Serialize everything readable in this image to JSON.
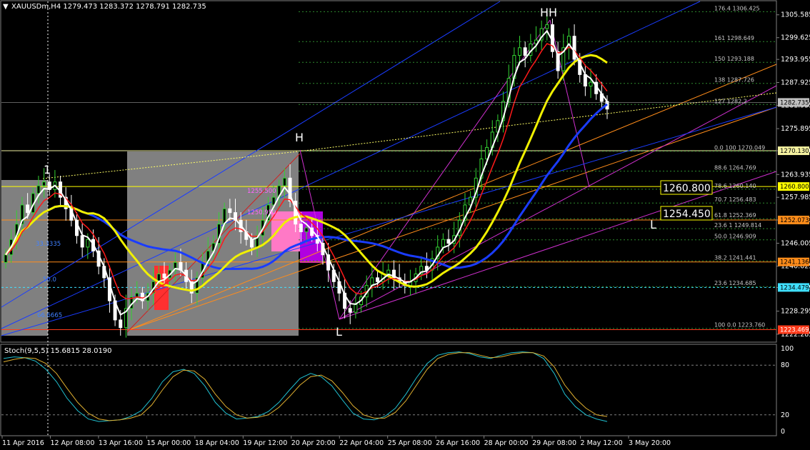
{
  "chart_data": {
    "type": "candlestick",
    "title": "XAUUSDm,H4  1279.473 1283.372 1278.791 1282.735",
    "symbol": "XAUUSDm",
    "timeframe": "H4",
    "ylim": [
      1220.4,
      1308.7
    ],
    "y_ticks": [
      "1305.585",
      "1299.625",
      "1293.955",
      "1287.925",
      "1281.955",
      "1275.895",
      "1270.130",
      "1263.935",
      "1257.985",
      "1252.073",
      "1246.005",
      "1240.025",
      "1234.479",
      "1228.295",
      "1222.285"
    ],
    "x_ticks": [
      "11 Apr 2016",
      "12 Apr 08:00",
      "13 Apr 16:00",
      "15 Apr 00:00",
      "18 Apr 04:00",
      "19 Apr 12:00",
      "20 Apr 20:00",
      "22 Apr 04:00",
      "25 Apr 08:00",
      "26 Apr 16:00",
      "28 Apr 00:00",
      "29 Apr 08:00",
      "2 May 12:00",
      "3 May 20:00"
    ],
    "candles_close": [
      1243,
      1247,
      1251,
      1256,
      1254,
      1259,
      1261,
      1262,
      1260,
      1262,
      1258,
      1255,
      1252,
      1248,
      1245,
      1247,
      1244,
      1240,
      1237,
      1231,
      1226,
      1224,
      1229,
      1232,
      1233,
      1231,
      1233,
      1236,
      1238,
      1237,
      1239,
      1241,
      1239,
      1236,
      1233,
      1237,
      1241,
      1244,
      1246,
      1251,
      1255,
      1254,
      1252,
      1249,
      1247,
      1245,
      1248,
      1252,
      1256,
      1258,
      1261,
      1263,
      1257,
      1251,
      1249,
      1250,
      1248,
      1246,
      1243,
      1239,
      1236,
      1233,
      1229,
      1228,
      1230,
      1232,
      1235,
      1237,
      1236,
      1238,
      1239,
      1237,
      1236,
      1235,
      1236,
      1238,
      1240,
      1239,
      1242,
      1245,
      1247,
      1246,
      1248,
      1252,
      1256,
      1258,
      1263,
      1268,
      1271,
      1275,
      1278,
      1283,
      1289,
      1295,
      1297,
      1295,
      1298,
      1299,
      1302,
      1303,
      1296,
      1291,
      1297,
      1300,
      1294,
      1290,
      1287,
      1288,
      1285,
      1283,
      1281
    ],
    "price_labels": [
      {
        "value": 1270.13,
        "text": "1270.130",
        "color": "#f5f2a0",
        "text_color": "#000000"
      },
      {
        "value": 1260.8,
        "text": "1260.800",
        "color": "#ffff00",
        "text_color": "#000000"
      },
      {
        "value": 1252.073,
        "text": "1252.073",
        "color": "#ff8c1a",
        "text_color": "#000000"
      },
      {
        "value": 1241.136,
        "text": "1241.136",
        "color": "#ff8c1a",
        "text_color": "#000000"
      },
      {
        "value": 1234.479,
        "text": "1234.479",
        "color": "#40e0ff",
        "text_color": "#000000"
      },
      {
        "value": 1223.469,
        "text": "1223.469",
        "color": "#ff3a1a",
        "text_color": "#ffffff"
      },
      {
        "value": 1282.735,
        "text": "1282.735",
        "color": "#c0c0c0",
        "text_color": "#000000"
      }
    ],
    "fib_levels": [
      {
        "value": 1306.4,
        "text": "176.4 1306.425"
      },
      {
        "value": 1298.6,
        "text": "161  1298.649"
      },
      {
        "value": 1293.2,
        "text": "150  1293.188"
      },
      {
        "value": 1287.7,
        "text": "138  1287.726"
      },
      {
        "value": 1282.2,
        "text": "127  1282.2"
      },
      {
        "value": 1270.0,
        "text": "0.0  100  1270.049"
      },
      {
        "value": 1264.8,
        "text": "88.6  1264.769"
      },
      {
        "value": 1260.1,
        "text": "78.6  1260.140"
      },
      {
        "value": 1256.5,
        "text": "70.7  1256.483"
      },
      {
        "value": 1252.4,
        "text": "61.8  1252.369"
      },
      {
        "value": 1249.8,
        "text": "23.6  1  1249.814"
      },
      {
        "value": 1246.9,
        "text": "50.0  1246.909"
      },
      {
        "value": 1241.4,
        "text": "38.2  1241.441"
      },
      {
        "value": 1234.7,
        "text": "23.6  1234.685"
      },
      {
        "value": 1223.8,
        "text": "100   0.0  1223.760"
      }
    ],
    "boxed_labels": [
      {
        "value": 1260.8,
        "text": "1260.800"
      },
      {
        "value": 1254.45,
        "text": "1254.450"
      }
    ],
    "pattern_labels": [
      "1",
      "H",
      "L",
      "HH",
      "L"
    ],
    "chart_tags": [
      "1255.500",
      "1250.950",
      "33.3335",
      "50.0",
      "66.6665"
    ],
    "oscillator": {
      "title": "Stoch(9,5,5) 15.6815 28.0190",
      "levels": [
        "100",
        "80",
        "20",
        "0"
      ],
      "main": [
        88,
        90,
        89,
        85,
        75,
        60,
        40,
        25,
        15,
        12,
        13,
        14,
        18,
        25,
        40,
        60,
        72,
        75,
        70,
        55,
        35,
        22,
        15,
        16,
        18,
        24,
        35,
        50,
        64,
        70,
        66,
        55,
        38,
        22,
        15,
        14,
        18,
        28,
        45,
        65,
        82,
        92,
        95,
        96,
        94,
        90,
        88,
        92,
        95,
        96,
        95,
        88,
        70,
        45,
        30,
        20,
        15,
        12
      ],
      "signal": [
        84,
        87,
        89,
        88,
        82,
        70,
        52,
        35,
        22,
        15,
        13,
        14,
        16,
        20,
        32,
        50,
        66,
        74,
        73,
        63,
        45,
        30,
        20,
        16,
        17,
        20,
        29,
        42,
        56,
        66,
        68,
        61,
        47,
        31,
        20,
        16,
        16,
        23,
        37,
        56,
        75,
        88,
        93,
        95,
        95,
        92,
        89,
        90,
        93,
        95,
        95,
        91,
        78,
        56,
        40,
        28,
        20,
        18
      ],
      "ylim": [
        0,
        100
      ]
    },
    "colors": {
      "bull": "#32d232",
      "bear": "#ffffff",
      "ema_red": "#ff1a1a",
      "ema_white": "#ffffff",
      "ma_yellow": "#f0f000",
      "ma_blue": "#1a3cff"
    }
  }
}
